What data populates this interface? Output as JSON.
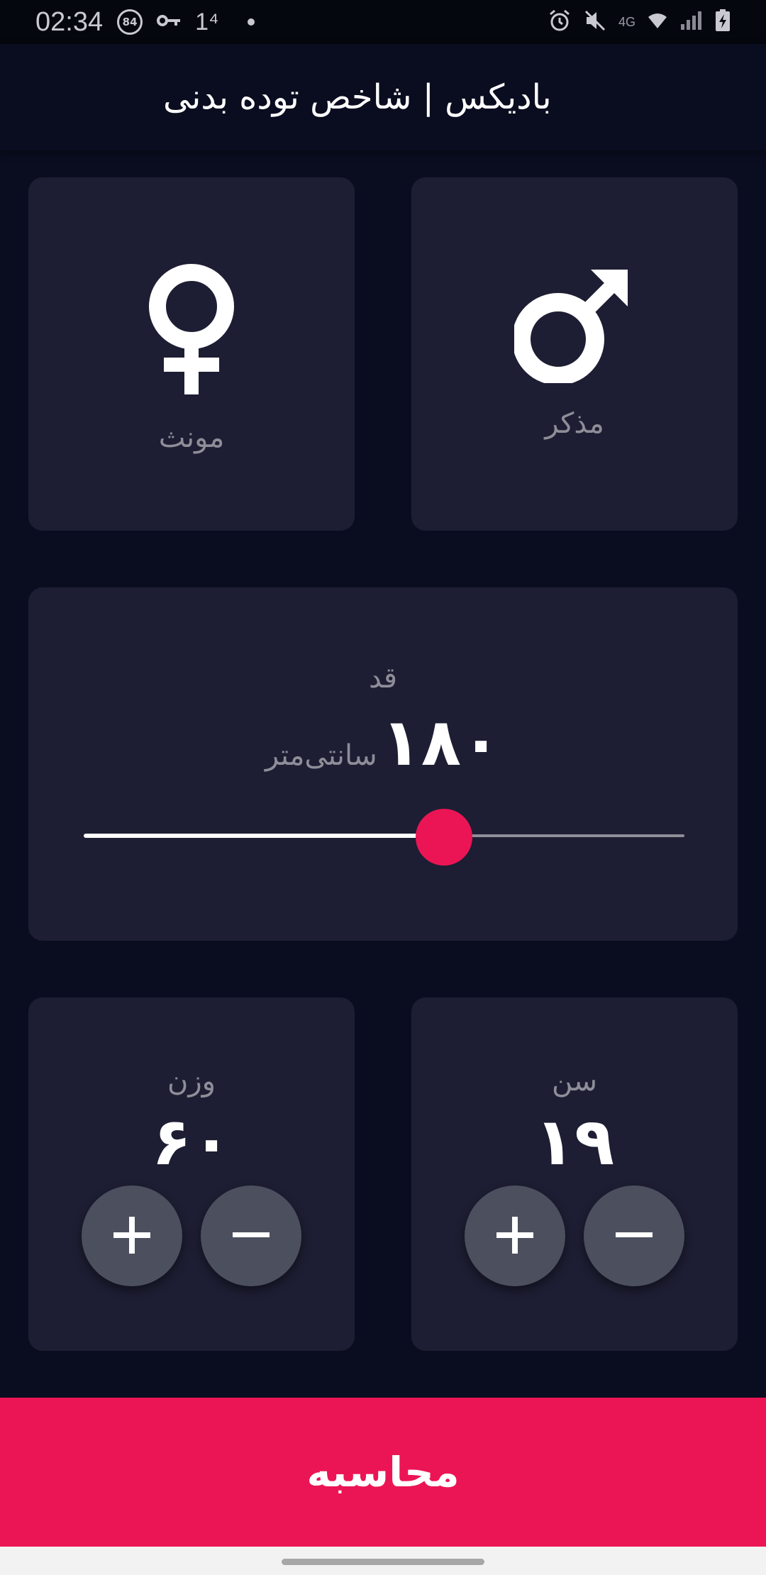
{
  "status_bar": {
    "time": "02:34",
    "badge": "84",
    "extra": "1⁴",
    "network": "4G"
  },
  "app_bar": {
    "title": "بادیکس | شاخص توده بدنی"
  },
  "gender": {
    "male_label": "مذکر",
    "female_label": "مونث"
  },
  "height": {
    "label": "قد",
    "value": "۱۸۰",
    "unit": "سانتی‌متر",
    "slider_fraction": 0.6
  },
  "weight": {
    "label": "وزن",
    "value": "۶۰"
  },
  "age": {
    "label": "سن",
    "value": "۱۹"
  },
  "calculate": {
    "label": "محاسبه"
  },
  "colors": {
    "background": "#0a0d1f",
    "card": "#1d1e33",
    "accent": "#eb1555",
    "label": "#8d8e98",
    "round_button": "#4c4f5e"
  },
  "icons": {
    "male": "male-symbol-icon",
    "female": "female-symbol-icon",
    "plus": "plus-icon",
    "minus": "minus-icon"
  }
}
